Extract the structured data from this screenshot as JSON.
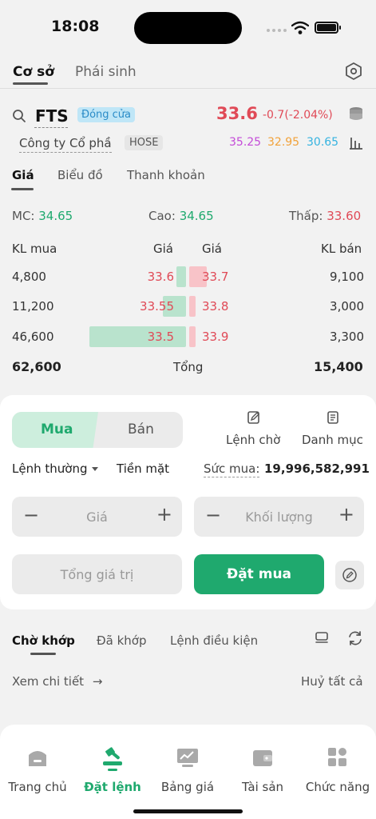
{
  "status": {
    "time": "18:08"
  },
  "main_tabs": [
    {
      "label": "Cơ sở"
    },
    {
      "label": "Phái sinh"
    }
  ],
  "stock": {
    "symbol": "FTS",
    "session_badge": "Đóng cửa",
    "price": "33.6",
    "change": "-0.7(-2.04%)",
    "company": "Công ty Cổ phầ",
    "exchange": "HOSE",
    "ceiling": "35.25",
    "reference": "32.95",
    "floor": "30.65"
  },
  "sub_tabs": [
    {
      "label": "Giá"
    },
    {
      "label": "Biểu đồ"
    },
    {
      "label": "Thanh khoản"
    }
  ],
  "summary": {
    "open_label": "MC:",
    "open_value": "34.65",
    "high_label": "Cao:",
    "high_value": "34.65",
    "low_label": "Thấp:",
    "low_value": "33.60"
  },
  "orderbook": {
    "headers": {
      "buy_vol": "KL mua",
      "buy_price": "Giá",
      "sell_price": "Giá",
      "sell_vol": "KL bán"
    },
    "rows": [
      {
        "buy_vol": "4,800",
        "buy_price": "33.6",
        "sell_price": "33.7",
        "sell_vol": "9,100",
        "buy_ratio": 0.1,
        "sell_ratio": 0.18
      },
      {
        "buy_vol": "11,200",
        "buy_price": "33.55",
        "sell_price": "33.8",
        "sell_vol": "3,000",
        "buy_ratio": 0.24,
        "sell_ratio": 0.06
      },
      {
        "buy_vol": "46,600",
        "buy_price": "33.5",
        "sell_price": "33.9",
        "sell_vol": "3,300",
        "buy_ratio": 1.0,
        "sell_ratio": 0.07
      }
    ],
    "total_buy": "62,600",
    "total_label": "Tổng",
    "total_sell": "15,400"
  },
  "order_form": {
    "buy_label": "Mua",
    "sell_label": "Bán",
    "pending_label": "Lệnh chờ",
    "portfolio_label": "Danh mục",
    "order_type": "Lệnh thường",
    "payment": "Tiền mặt",
    "power_label": "Sức mua:",
    "power_value": "19,996,582,991",
    "price_placeholder": "Giá",
    "qty_placeholder": "Khối lượng",
    "total_placeholder": "Tổng giá trị",
    "submit_label": "Đặt mua",
    "minus": "−",
    "plus": "+"
  },
  "orders_tabs": [
    {
      "label": "Chờ khớp"
    },
    {
      "label": "Đã khớp"
    },
    {
      "label": "Lệnh điều kiện"
    }
  ],
  "orders": {
    "detail_link": "Xem chi tiết",
    "cancel_all": "Huỷ tất cả"
  },
  "nav": [
    {
      "label": "Trang chủ",
      "icon": "home-icon"
    },
    {
      "label": "Đặt lệnh",
      "icon": "gavel-icon"
    },
    {
      "label": "Bảng giá",
      "icon": "chart-board-icon"
    },
    {
      "label": "Tài sản",
      "icon": "wallet-icon"
    },
    {
      "label": "Chức năng",
      "icon": "grid-icon"
    }
  ],
  "colors": {
    "accent": "#1fa96e",
    "down": "#e04a57",
    "ceiling": "#c44bd8",
    "reference": "#f1a23a",
    "floor": "#35b3e0"
  }
}
